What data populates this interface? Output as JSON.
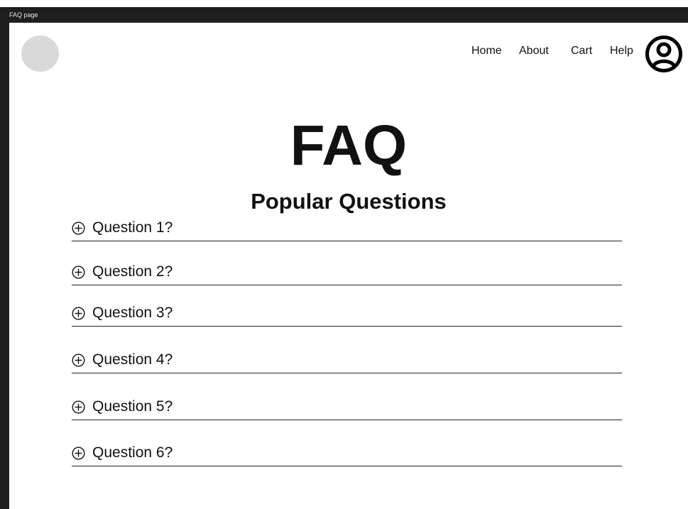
{
  "window": {
    "title": "FAQ page"
  },
  "nav": {
    "home": "Home",
    "about": "About",
    "cart": "Cart",
    "help": "Help"
  },
  "header": {
    "title": "FAQ",
    "subtitle": "Popular Questions"
  },
  "faq": {
    "items": [
      {
        "question": "Question 1?"
      },
      {
        "question": "Question 2?"
      },
      {
        "question": "Question 3?"
      },
      {
        "question": "Question 4?"
      },
      {
        "question": "Question 5?"
      },
      {
        "question": "Question 6?"
      }
    ]
  },
  "icons": {
    "expand": "plus-circle-icon",
    "account": "user-circle-icon"
  },
  "colors": {
    "logo_placeholder": "#d9d9d9",
    "frame_bar": "#1e1e1e",
    "text": "#111111"
  }
}
